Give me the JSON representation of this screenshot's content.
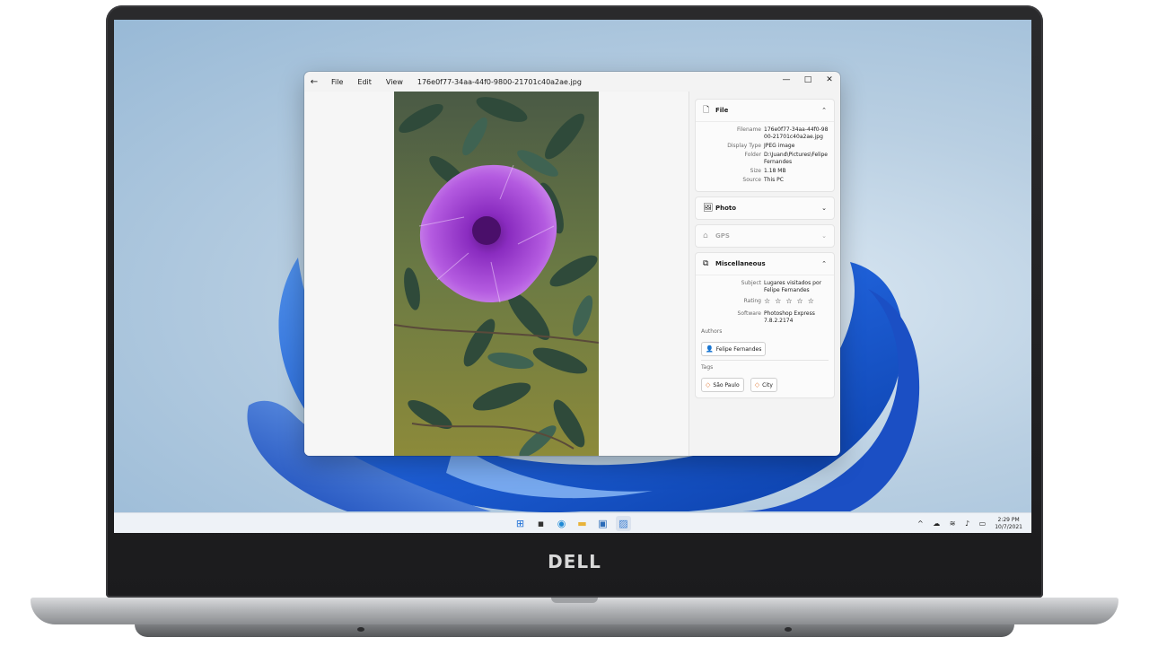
{
  "brand": "DELL",
  "window": {
    "back_glyph": "←",
    "menu": [
      "File",
      "Edit",
      "View"
    ],
    "filename": "176e0f77-34aa-44f0-9800-21701c40a2ae.jpg",
    "minimize": "—",
    "maximize": "□",
    "close": "✕"
  },
  "panel": {
    "file": {
      "title": "File",
      "expanded": true,
      "rows": [
        {
          "key": "Filename",
          "value": "176e0f77-34aa-44f0-9800-21701c40a2ae.jpg"
        },
        {
          "key": "Display Type",
          "value": "JPEG image"
        },
        {
          "key": "Folder",
          "value": "D:\\Juand\\Pictures\\Felipe Fernandes"
        },
        {
          "key": "Size",
          "value": "1.18 MB"
        },
        {
          "key": "Source",
          "value": "This PC"
        }
      ]
    },
    "photo": {
      "title": "Photo",
      "expanded": false
    },
    "gps": {
      "title": "GPS",
      "expanded": false,
      "disabled": true
    },
    "misc": {
      "title": "Miscellaneous",
      "expanded": true,
      "subject_key": "Subject",
      "subject_value": "Lugares visitados por Felipe Fernandes",
      "rating_key": "Rating",
      "rating_stars": "☆☆☆☆☆",
      "rating_value": 0,
      "software_key": "Software",
      "software_value": "Photoshop Express 7.8.2.2174",
      "authors_label": "Authors",
      "authors": [
        "Felipe Fernandes"
      ],
      "tags_label": "Tags",
      "tags": [
        "São Paulo",
        "City"
      ]
    }
  },
  "taskbar": {
    "icons": [
      "start-icon",
      "task-view-icon",
      "edge-icon",
      "file-explorer-icon",
      "store-icon",
      "photos-icon"
    ],
    "tray_icons": [
      "chevron-up-icon",
      "cloud-icon",
      "wifi-icon",
      "volume-icon",
      "battery-icon"
    ],
    "time": "2:29 PM",
    "date": "10/7/2021"
  }
}
